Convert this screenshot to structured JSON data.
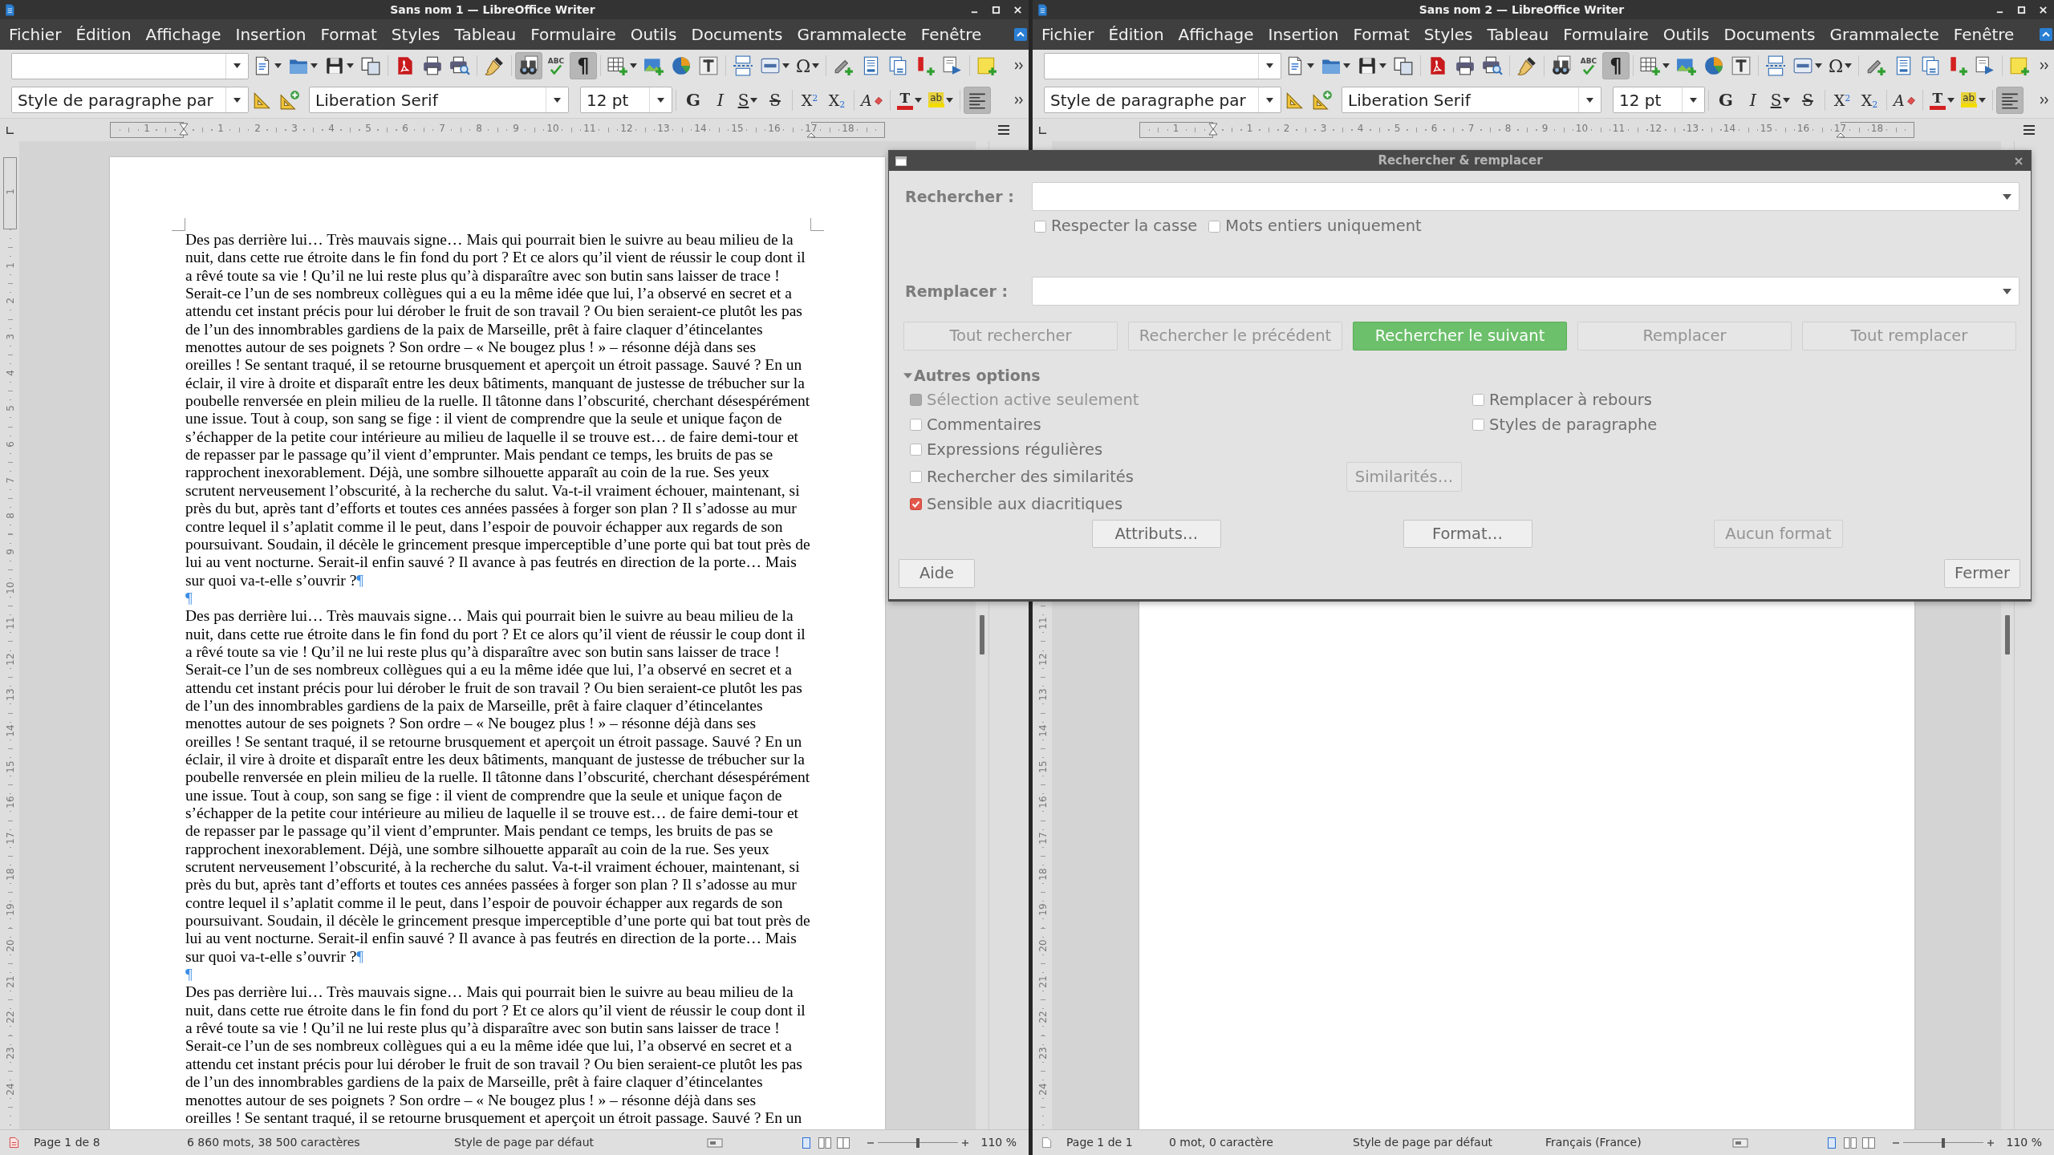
{
  "windows": [
    {
      "title": "Sans nom 1 — LibreOffice Writer",
      "menus": [
        "Fichier",
        "Édition",
        "Affichage",
        "Insertion",
        "Format",
        "Styles",
        "Tableau",
        "Formulaire",
        "Outils",
        "Documents",
        "Grammalecte",
        "Fenêtre"
      ],
      "standard_toolbar": [
        {
          "on": false
        },
        {
          "on": false
        },
        {
          "on": false
        },
        {
          "on": false
        },
        {
          "on": false
        },
        {
          "on": false
        },
        {
          "on": false
        },
        {
          "on": false
        },
        {
          "on": true
        },
        {
          "glyph": "ABC"
        },
        {
          "glyph": "¶",
          "on": true
        },
        {
          "on": false
        },
        {
          "on": false
        },
        {
          "on": false
        },
        {
          "on": false
        },
        {
          "on": false
        },
        {
          "on": false
        },
        {
          "glyph": "Ω",
          "on": false
        },
        {
          "on": false
        },
        {
          "on": false
        },
        {
          "on": false
        },
        {
          "on": false
        },
        {
          "on": false
        },
        {
          "on": false
        }
      ],
      "formatting_toolbar": {
        "paragraph_style": "Style de paragraphe par",
        "style_buttons": [
          {
            "on": false
          },
          {
            "on": false
          }
        ],
        "font_name": "Liberation Serif",
        "font_size": "12 pt",
        "buttons": [
          {
            "glyph": "G",
            "on": false
          },
          {
            "glyph": "I",
            "on": false
          },
          {
            "glyph": "S",
            "on": false
          },
          {
            "glyph": "S",
            "on": false
          },
          {
            "glyph": "X$^{2}$",
            "on": false
          },
          {
            "glyph": "X$_{2}$",
            "on": false
          },
          {
            "glyph": "A",
            "on": false
          },
          {
            "glyph": "T",
            "on": false
          },
          {
            "glyph": "ab",
            "on": false
          },
          {
            "on": true
          }
        ]
      },
      "ruler": [
        "1",
        "1",
        "2",
        "3",
        "4",
        "5",
        "6",
        "7",
        "8",
        "9",
        "10",
        "11",
        "12",
        "13",
        "14",
        "15",
        "16",
        "17",
        "18"
      ],
      "vertical_ruler": [
        "1",
        "1",
        "2",
        "3",
        "4",
        "5",
        "6",
        "7",
        "8",
        "9",
        "10",
        "11",
        "12",
        "13",
        "14",
        "15",
        "16",
        "17",
        "18",
        "19",
        "20",
        "21",
        "22",
        "23",
        "24"
      ],
      "document": {
        "paragraphs": [
          {
            "lines": [
              "Des pas derrière lui… Très mauvais signe… Mais qui pourrait bien le suivre au beau milieu de la",
              "nuit, dans cette rue étroite dans le fin fond du port ? Et ce alors qu’il vient de réussir le coup dont il",
              "a rêvé toute sa vie ! Qu’il ne lui reste plus qu’à disparaître avec son butin sans laisser de trace !",
              "Serait-ce l’un de ses nombreux collègues qui a eu la même idée que lui, l’a observé en secret et a",
              "attendu cet instant précis pour lui dérober le fruit de son travail ? Ou bien seraient-ce plutôt les pas",
              "de l’un des innombrables gardiens de la paix de Marseille, prêt à faire claquer d’étincelantes",
              "menottes autour de ses poignets ? Son ordre – « Ne bougez plus ! » – résonne déjà dans ses",
              "oreilles ! Se sentant traqué, il se retourne brusquement et aperçoit un étroit passage. Sauvé ? En un",
              "éclair, il vire à droite et disparaît entre les deux bâtiments, manquant de justesse de trébucher sur la",
              "poubelle renversée en plein milieu de la ruelle. Il tâtonne dans l’obscurité, cherchant désespérément",
              "une issue. Tout à coup, son sang se fige : il vient de comprendre que la seule et unique façon de",
              "s’échapper de la petite cour intérieure au milieu de laquelle il se trouve est… de faire demi-tour et",
              "de repasser par le passage qu’il vient d’emprunter. Mais pendant ce temps, les bruits de pas se",
              "rapprochent inexorablement. Déjà, une sombre silhouette apparaît au coin de la rue. Ses yeux",
              "scrutent nerveusement l’obscurité, à la recherche du salut. Va-t-il vraiment échouer, maintenant, si",
              "près du but, après tant d’efforts et toutes ces années passées à forger son plan ? Il s’adosse au mur",
              "contre lequel il s’aplatit comme il le peut, dans l’espoir de pouvoir échapper aux regards de son",
              "poursuivant. Soudain, il décèle le grincement presque imperceptible d’une porte qui bat tout près de",
              "lui au vent nocturne. Serait-il enfin sauvé ? Il avance à pas feutrés en direction de la porte… Mais",
              "sur quoi va-t-elle s’ouvrir ?"
            ],
            "mark": "¶"
          },
          {
            "mark": "¶"
          },
          {
            "lines": [
              "Des pas derrière lui… Très mauvais signe… Mais qui pourrait bien le suivre au beau milieu de la",
              "nuit, dans cette rue étroite dans le fin fond du port ? Et ce alors qu’il vient de réussir le coup dont il",
              "a rêvé toute sa vie ! Qu’il ne lui reste plus qu’à disparaître avec son butin sans laisser de trace !",
              "Serait-ce l’un de ses nombreux collègues qui a eu la même idée que lui, l’a observé en secret et a",
              "attendu cet instant précis pour lui dérober le fruit de son travail ? Ou bien seraient-ce plutôt les pas",
              "de l’un des innombrables gardiens de la paix de Marseille, prêt à faire claquer d’étincelantes",
              "menottes autour de ses poignets ? Son ordre – « Ne bougez plus ! » – résonne déjà dans ses",
              "oreilles ! Se sentant traqué, il se retourne brusquement et aperçoit un étroit passage. Sauvé ? En un",
              "éclair, il vire à droite et disparaît entre les deux bâtiments, manquant de justesse de trébucher sur la",
              "poubelle renversée en plein milieu de la ruelle. Il tâtonne dans l’obscurité, cherchant désespérément",
              "une issue. Tout à coup, son sang se fige : il vient de comprendre que la seule et unique façon de",
              "s’échapper de la petite cour intérieure au milieu de laquelle il se trouve est… de faire demi-tour et",
              "de repasser par le passage qu’il vient d’emprunter. Mais pendant ce temps, les bruits de pas se",
              "rapprochent inexorablement. Déjà, une sombre silhouette apparaît au coin de la rue. Ses yeux",
              "scrutent nerveusement l’obscurité, à la recherche du salut. Va-t-il vraiment échouer, maintenant, si",
              "près du but, après tant d’efforts et toutes ces années passées à forger son plan ? Il s’adosse au mur",
              "contre lequel il s’aplatit comme il le peut, dans l’espoir de pouvoir échapper aux regards de son",
              "poursuivant. Soudain, il décèle le grincement presque imperceptible d’une porte qui bat tout près de",
              "lui au vent nocturne. Serait-il enfin sauvé ? Il avance à pas feutrés en direction de la porte… Mais",
              "sur quoi va-t-elle s’ouvrir ?"
            ],
            "mark": "¶"
          },
          {
            "mark": "¶"
          },
          {
            "lines": [
              "Des pas derrière lui… Très mauvais signe… Mais qui pourrait bien le suivre au beau milieu de la",
              "nuit, dans cette rue étroite dans le fin fond du port ? Et ce alors qu’il vient de réussir le coup dont il",
              "a rêvé toute sa vie ! Qu’il ne lui reste plus qu’à disparaître avec son butin sans laisser de trace !",
              "Serait-ce l’un de ses nombreux collègues qui a eu la même idée que lui, l’a observé en secret et a",
              "attendu cet instant précis pour lui dérober le fruit de son travail ? Ou bien seraient-ce plutôt les pas",
              "de l’un des innombrables gardiens de la paix de Marseille, prêt à faire claquer d’étincelantes",
              "menottes autour de ses poignets ? Son ordre – « Ne bougez plus ! » – résonne déjà dans ses",
              "oreilles ! Se sentant traqué, il se retourne brusquement et aperçoit un étroit passage. Sauvé ? En un"
            ]
          }
        ]
      },
      "status_bar": {
        "modified": true,
        "page": "Page 1 de 8",
        "words": "6 860 mots, 38 500 caractères",
        "page_style": "Style de page par défaut",
        "view_buttons": [
          {
            "selected": true
          },
          {
            "selected": false
          },
          {
            "selected": false
          }
        ],
        "zoom_slider": {
          "level": 0.5
        },
        "zoom": "110 %"
      }
    },
    {
      "title": "Sans nom 2 — LibreOffice Writer",
      "menus": [
        "Fichier",
        "Édition",
        "Affichage",
        "Insertion",
        "Format",
        "Styles",
        "Tableau",
        "Formulaire",
        "Outils",
        "Documents",
        "Grammalecte",
        "Fenêtre"
      ],
      "standard_toolbar": [
        {
          "on": false
        },
        {
          "on": false
        },
        {
          "on": false
        },
        {
          "on": false
        },
        {
          "on": false
        },
        {
          "on": false
        },
        {
          "on": false
        },
        {
          "on": false
        },
        {
          "on": false
        },
        {
          "glyph": "ABC"
        },
        {
          "glyph": "¶",
          "on": true
        },
        {
          "on": false
        },
        {
          "on": false
        },
        {
          "on": false
        },
        {
          "on": false
        },
        {
          "on": false
        },
        {
          "on": false
        },
        {
          "glyph": "Ω",
          "on": false
        },
        {
          "on": false
        },
        {
          "on": false
        },
        {
          "on": false
        },
        {
          "on": false
        },
        {
          "on": false
        },
        {
          "on": false
        }
      ],
      "formatting_toolbar": {
        "paragraph_style": "Style de paragraphe par",
        "style_buttons": [
          {
            "on": false
          },
          {
            "on": false
          }
        ],
        "font_name": "Liberation Serif",
        "font_size": "12 pt",
        "buttons": [
          {
            "glyph": "G",
            "on": false
          },
          {
            "glyph": "I",
            "on": false
          },
          {
            "glyph": "S",
            "on": false
          },
          {
            "glyph": "S",
            "on": false
          },
          {
            "glyph": "X$^{2}$",
            "on": false
          },
          {
            "glyph": "X$_{2}$",
            "on": false
          },
          {
            "glyph": "A",
            "on": false
          },
          {
            "glyph": "T",
            "on": false
          },
          {
            "glyph": "ab",
            "on": false
          },
          {
            "on": true
          }
        ]
      },
      "ruler": [
        "1",
        "1",
        "2",
        "3",
        "4",
        "5",
        "6",
        "7",
        "8",
        "9",
        "10",
        "11",
        "12",
        "13",
        "14",
        "15",
        "16",
        "17",
        "18"
      ],
      "vertical_ruler": [
        "11",
        "12",
        "13",
        "14",
        "15",
        "16",
        "17",
        "18",
        "19",
        "20",
        "21",
        "22",
        "23",
        "24"
      ],
      "status_bar": {
        "modified": false,
        "page": "Page 1 de 1",
        "words": "0 mot, 0 caractère",
        "page_style": "Style de page par défaut",
        "language": "Français (France)",
        "view_buttons": [
          {
            "selected": true
          },
          {
            "selected": false
          },
          {
            "selected": false
          }
        ],
        "zoom_slider": {
          "level": 0.5
        },
        "zoom": "110 %"
      }
    }
  ],
  "dialog": {
    "title": "Rechercher & remplacer",
    "find_label": "Rechercher :",
    "find_options": [
      {
        "label": "Respecter la casse",
        "checked": false,
        "disabled": false
      },
      {
        "label": "Mots entiers uniquement",
        "checked": false,
        "disabled": false
      }
    ],
    "replace_label": "Remplacer :",
    "action_buttons": [
      {
        "label": "Tout rechercher",
        "disabled": true,
        "default": false
      },
      {
        "label": "Rechercher le précédent",
        "disabled": true,
        "default": false
      },
      {
        "label": "Rechercher le suivant",
        "disabled": false,
        "default": true
      },
      {
        "label": "Remplacer",
        "disabled": true,
        "default": false
      },
      {
        "label": "Tout remplacer",
        "disabled": true,
        "default": false
      }
    ],
    "more_options": {
      "label": "Autres options",
      "expanded": true
    },
    "left_options": [
      {
        "label": "Sélection active seulement",
        "checked": false,
        "disabled": true
      },
      {
        "label": "Commentaires",
        "checked": false,
        "disabled": false
      },
      {
        "label": "Expressions régulières",
        "checked": false,
        "disabled": false
      },
      {
        "label": "Rechercher des similarités",
        "checked": false,
        "disabled": false,
        "button": {
          "label": "Similarités…",
          "disabled": true
        }
      },
      {
        "label": "Sensible aux diacritiques",
        "checked": true,
        "disabled": false
      }
    ],
    "right_options": [
      {
        "label": "Remplacer à rebours",
        "checked": false,
        "disabled": false
      },
      {
        "label": "Styles de paragraphe",
        "checked": false,
        "disabled": false
      }
    ],
    "format_buttons": [
      {
        "label": "Attributs…",
        "disabled": false
      },
      {
        "label": "Format…",
        "disabled": false
      },
      {
        "label": "Aucun format",
        "disabled": true
      }
    ],
    "help_button": "Aide",
    "close_button": "Fermer"
  }
}
